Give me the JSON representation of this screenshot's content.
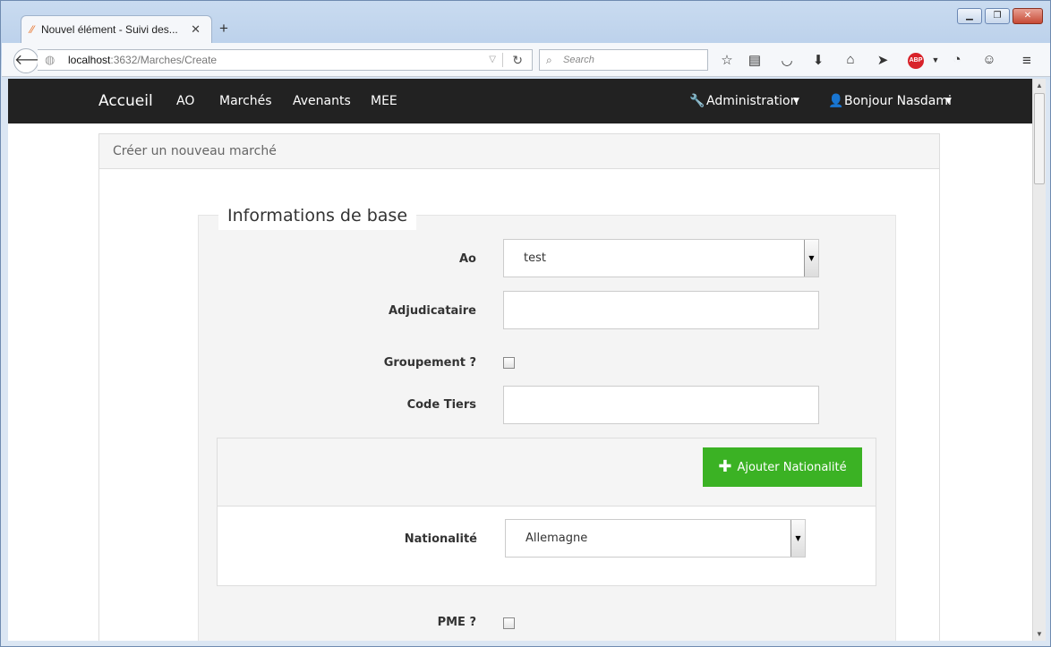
{
  "browser": {
    "tab_title": "Nouvel élément - Suivi des...",
    "tab_close": "✕",
    "new_tab": "+",
    "url_host": "localhost",
    "url_path": ":3632/Marches/Create",
    "search_placeholder": "Search"
  },
  "nav": {
    "brand": "Accueil",
    "items": [
      "AO",
      "Marchés",
      "Avenants",
      "MEE"
    ],
    "admin": "Administration",
    "user": "Bonjour Nasdami"
  },
  "panel": {
    "title": "Créer un nouveau marché",
    "legend": "Informations de base"
  },
  "form": {
    "ao_label": "Ao",
    "ao_value": "test",
    "adjudicataire_label": "Adjudicataire",
    "groupement_label": "Groupement ?",
    "code_tiers_label": "Code Tiers",
    "add_nationalite_button": "Ajouter Nationalité",
    "nationalite_label": "Nationalité",
    "nationalite_value": "Allemagne",
    "pme_label": "PME ?"
  }
}
